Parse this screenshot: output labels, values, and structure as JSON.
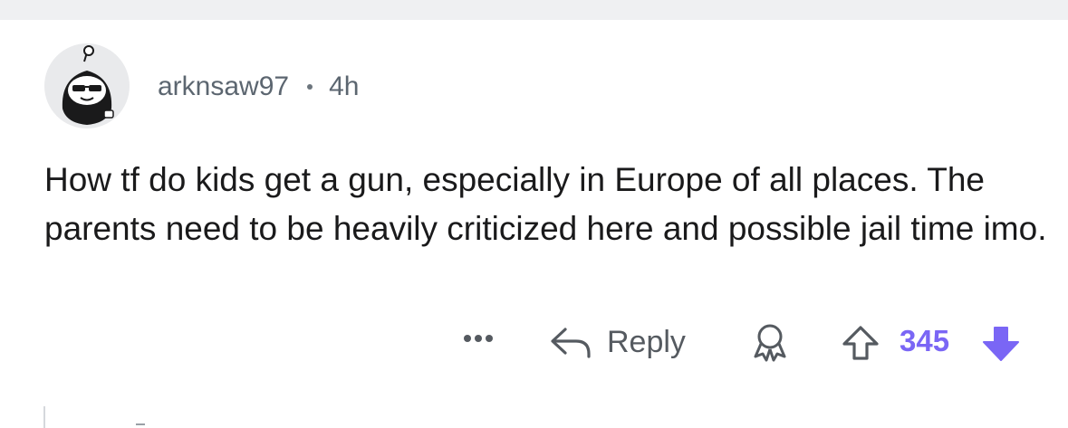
{
  "comment": {
    "username": "arknsaw97",
    "separator": "•",
    "time": "4h",
    "body": "How tf do kids get a gun, especially in Europe of all places. The parents need to be heavily criticized here and possible jail time imo."
  },
  "actions": {
    "more_icon": "ellipsis-icon",
    "reply_icon": "reply-arrow-icon",
    "reply_label": "Reply",
    "award_icon": "award-icon",
    "upvote_icon": "upvote-arrow-outline-icon",
    "vote_count": "345",
    "downvote_icon": "downvote-arrow-filled-icon"
  },
  "colors": {
    "background": "#ffffff",
    "top_strip": "#eff0f2",
    "text": "#1a1a1b",
    "meta_text": "#5c6670",
    "vote_accent": "#7a66f5"
  }
}
